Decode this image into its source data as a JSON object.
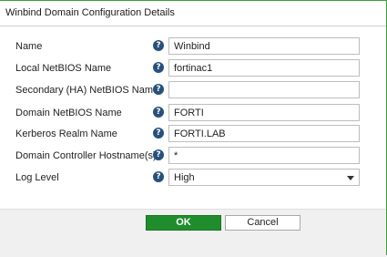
{
  "dialog": {
    "title": "Winbind Domain Configuration Details"
  },
  "fields": [
    {
      "label": "Name",
      "value": "Winbind",
      "help_icon": "question-circle-icon"
    },
    {
      "label": "Local NetBIOS Name",
      "value": "fortinac1",
      "help_icon": "question-circle-icon"
    },
    {
      "label": "Secondary (HA) NetBIOS Name",
      "value": "",
      "help_icon": "question-circle-icon"
    },
    {
      "label": "Domain NetBIOS Name",
      "value": "FORTI",
      "help_icon": "question-circle-icon"
    },
    {
      "label": "Kerberos Realm Name",
      "value": "FORTI.LAB",
      "help_icon": "question-circle-icon"
    },
    {
      "label": "Domain Controller Hostname(s)",
      "value": "*",
      "help_icon": "question-circle-icon"
    },
    {
      "label": "Log Level",
      "value": "High",
      "help_icon": "question-circle-icon",
      "type": "select"
    }
  ],
  "help_glyph": "?",
  "buttons": {
    "ok_label": "OK",
    "cancel_label": "Cancel"
  },
  "colors": {
    "ok_button": "#1f8d2c",
    "help_icon": "#28507c",
    "window_border": "#3aa335"
  }
}
